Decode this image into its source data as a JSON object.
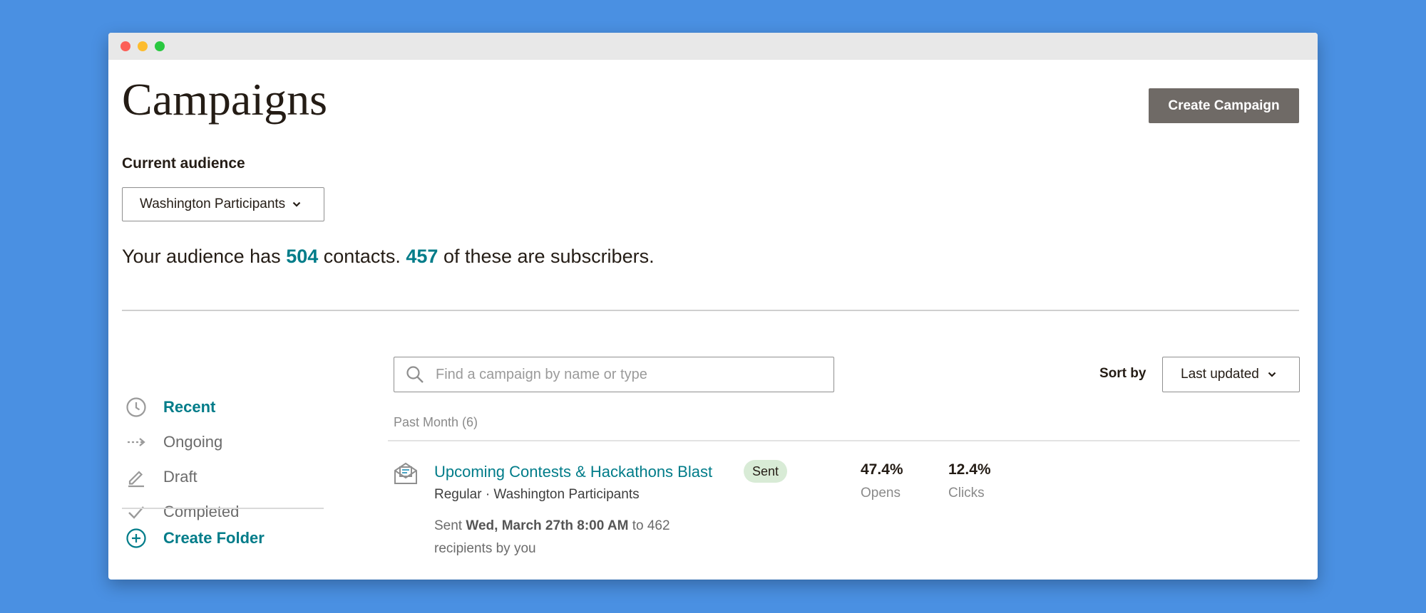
{
  "page": {
    "title": "Campaigns",
    "create_campaign_label": "Create Campaign"
  },
  "audience": {
    "label": "Current audience",
    "selected": "Washington Participants",
    "summary_prefix": "Your audience has",
    "contacts": "504",
    "contacts_suffix": "contacts.",
    "subscribers": "457",
    "subscribers_suffix": "of these are subscribers."
  },
  "sidebar": {
    "items": [
      {
        "label": "Recent",
        "icon": "clock-icon",
        "active": true
      },
      {
        "label": "Ongoing",
        "icon": "dashed-arrow-icon",
        "active": false
      },
      {
        "label": "Draft",
        "icon": "pencil-icon",
        "active": false
      },
      {
        "label": "Completed",
        "icon": "checkmark-icon",
        "active": false
      }
    ],
    "create_folder_label": "Create Folder"
  },
  "search": {
    "placeholder": "Find a campaign by name or type"
  },
  "sort": {
    "label": "Sort by",
    "selected": "Last updated"
  },
  "group": {
    "label": "Past Month (6)"
  },
  "campaigns": [
    {
      "title": "Upcoming Contests & Hackathons Blast",
      "status": "Sent",
      "meta": "Regular · Washington Participants",
      "sent_prefix": "Sent",
      "sent_date": "Wed, March 27th 8:00 AM",
      "sent_suffix": "to 462 recipients by you",
      "opens_value": "47.4%",
      "opens_label": "Opens",
      "clicks_value": "12.4%",
      "clicks_label": "Clicks"
    }
  ],
  "colors": {
    "background": "#4a90e2",
    "accent": "#007c89",
    "button": "#6f6a66",
    "sent_badge": "#d8ebd6"
  }
}
